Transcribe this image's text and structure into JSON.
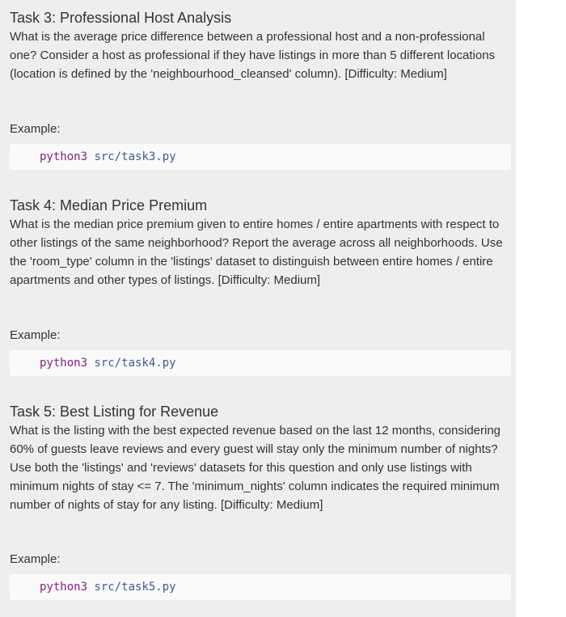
{
  "tasks": [
    {
      "title": "Task 3: Professional Host Analysis",
      "description": "What is the average price difference between a professional host and a non-professional one? Consider a host as professional if they have listings in more than 5 different locations (location is defined by the 'neighbourhood_cleansed' column). [Difficulty: Medium]",
      "example_label": "Example:",
      "command": "python3",
      "arg": "src/task3.py"
    },
    {
      "title": "Task 4: Median Price Premium",
      "description": "What is the median price premium given to entire homes / entire apartments with respect to other listings of the same neighborhood? Report the average across all neighborhoods. Use the 'room_type' column in the 'listings' dataset to distinguish between entire homes / entire apartments and other types of listings. [Difficulty: Medium]",
      "example_label": "Example:",
      "command": "python3",
      "arg": "src/task4.py"
    },
    {
      "title": "Task 5: Best Listing for Revenue",
      "description": "What is the listing with the best expected revenue based on the last 12 months, considering 60% of guests leave reviews and every guest will stay only the minimum number of nights? Use both the 'listings' and 'reviews' datasets for this question and only use listings with minimum nights of stay <= 7. The 'minimum_nights' column indicates the required minimum number of nights of stay for any listing. [Difficulty: Medium]",
      "example_label": "Example:",
      "command": "python3",
      "arg": "src/task5.py"
    }
  ]
}
